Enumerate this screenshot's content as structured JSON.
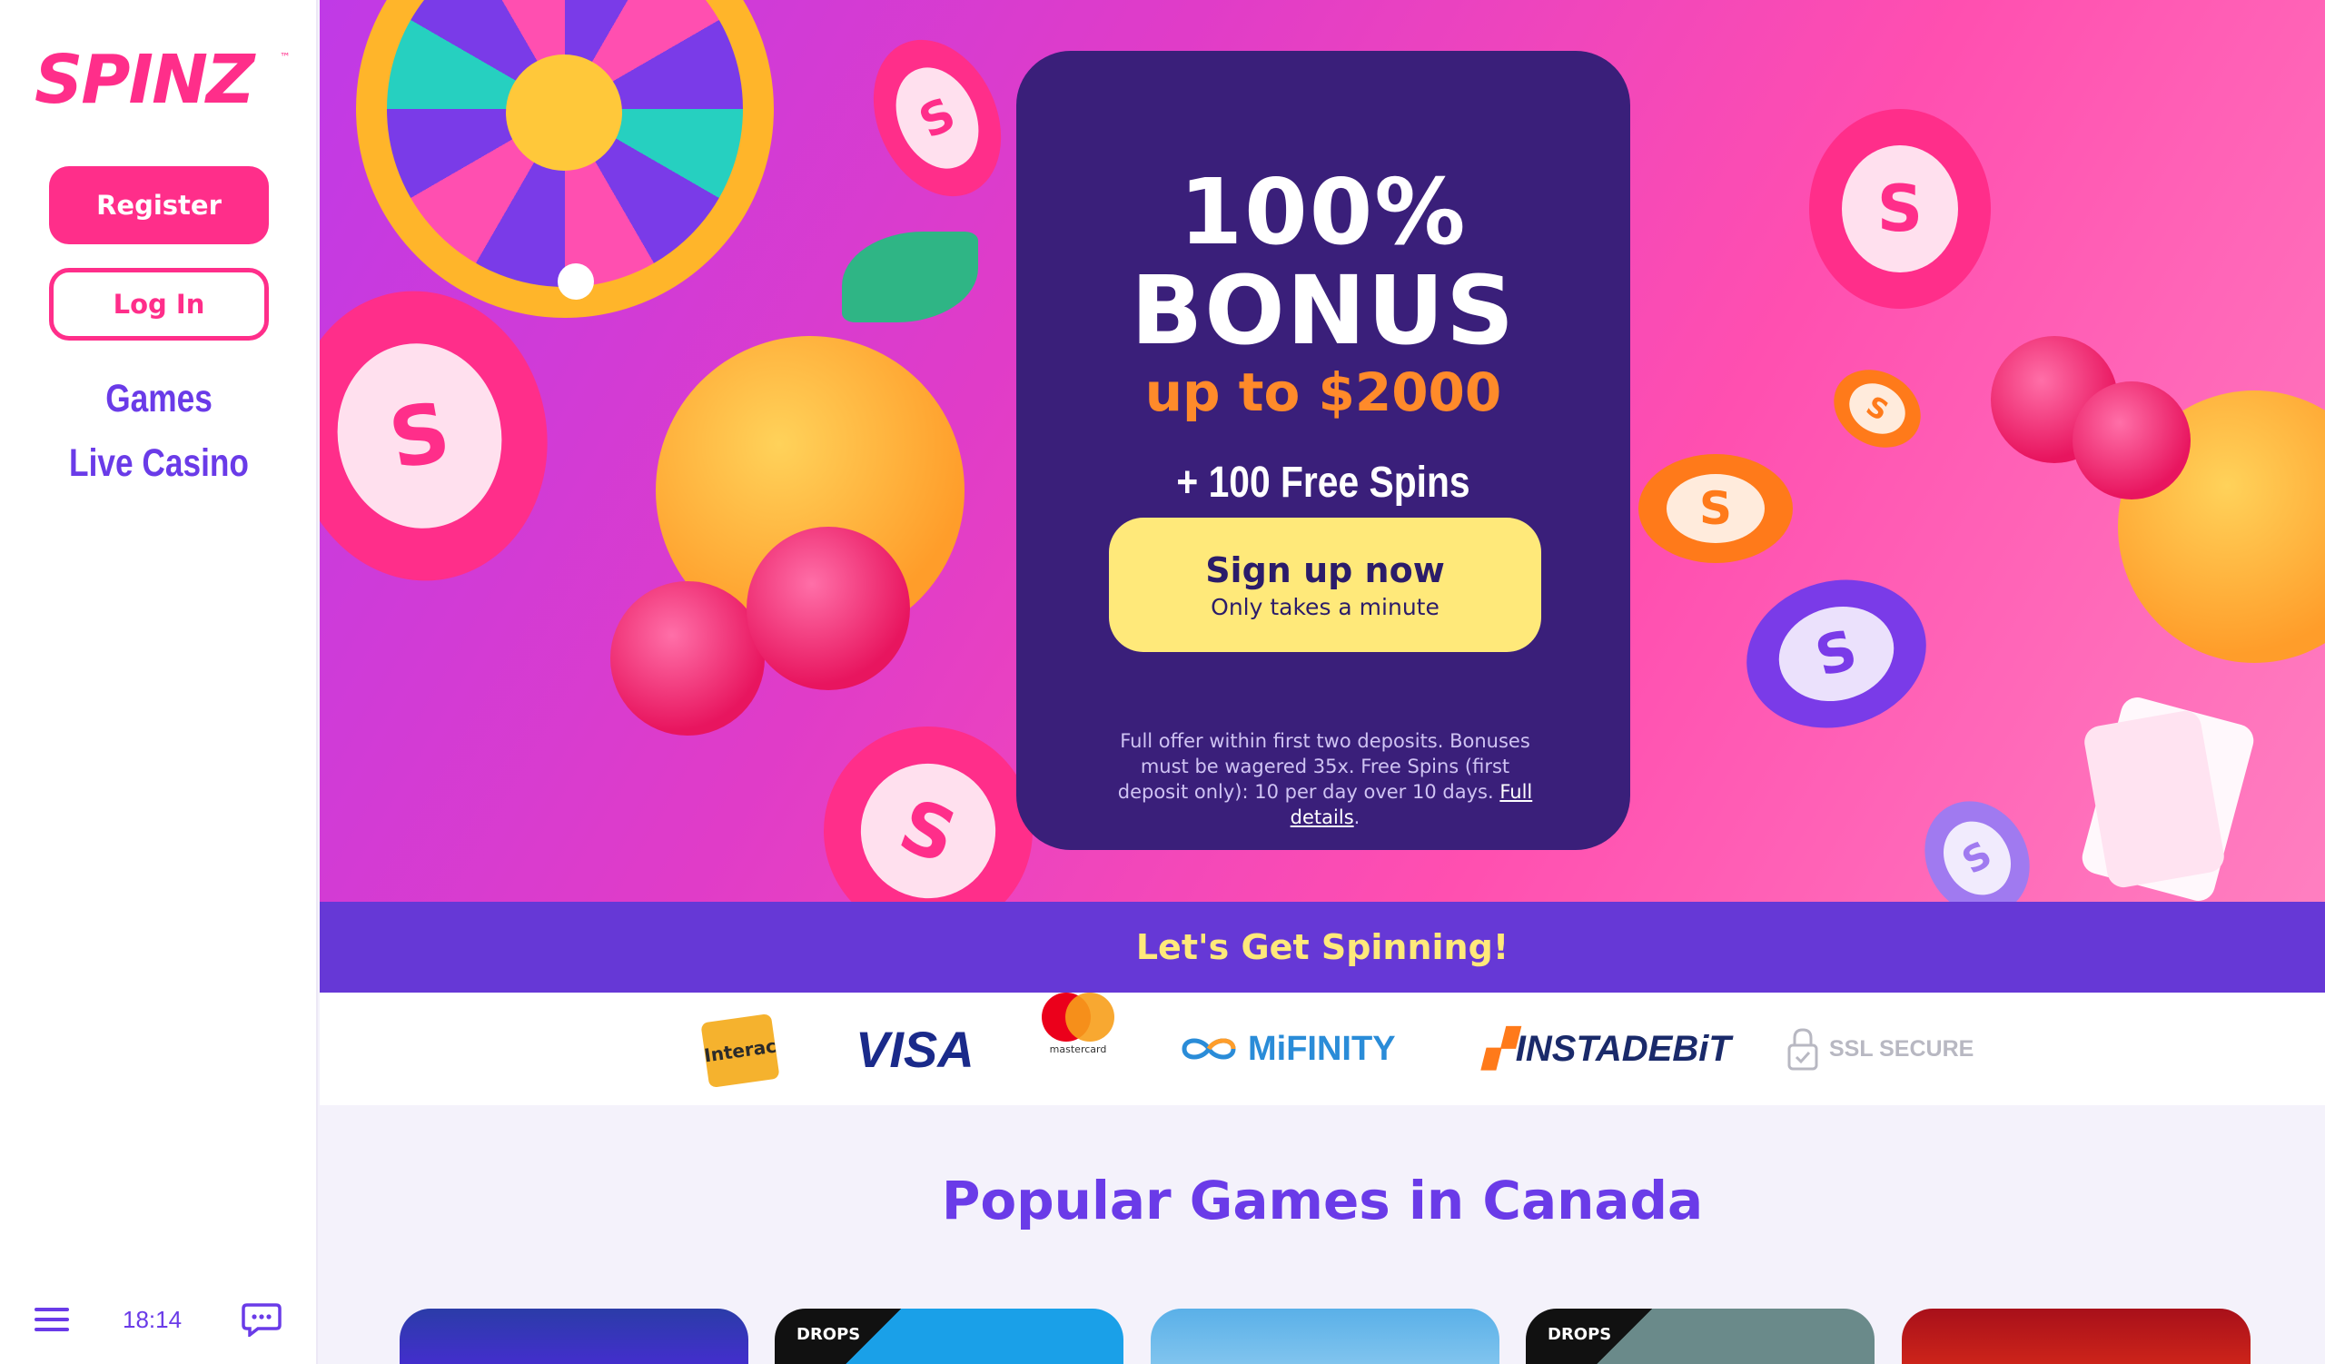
{
  "brand": {
    "name": "SPINZ",
    "tm": "™",
    "accent": "#ff2e8a",
    "purple": "#6a3be8"
  },
  "sidebar": {
    "register_label": "Register",
    "login_label": "Log In",
    "nav": [
      {
        "label": "Games"
      },
      {
        "label": "Live Casino"
      }
    ],
    "clock": "18:14"
  },
  "hero": {
    "line1": "100%",
    "line2": "BONUS",
    "line3": "up to $2000",
    "line4": "+ 100 Free Spins",
    "cta_main": "Sign up now",
    "cta_sub": "Only takes a minute",
    "terms": "Full offer within first two deposits. Bonuses must be wagered 35x. Free Spins (first deposit only): 10 per day over 10 days.",
    "terms_link": "Full details",
    "terms_end": "."
  },
  "band": {
    "text": "Let's Get Spinning!"
  },
  "payments": {
    "interac": "Interac",
    "visa": "VISA",
    "mastercard": "mastercard",
    "mifinity": "MiFINITY",
    "instadebit": "INSTADEBiT",
    "ssl": "SSL SECURE"
  },
  "popular": {
    "title": "Popular Games in Canada",
    "tiles": [
      {
        "label": ""
      },
      {
        "label": "DROPS"
      },
      {
        "label": ""
      },
      {
        "label": "DROPS"
      },
      {
        "label": ""
      }
    ]
  }
}
